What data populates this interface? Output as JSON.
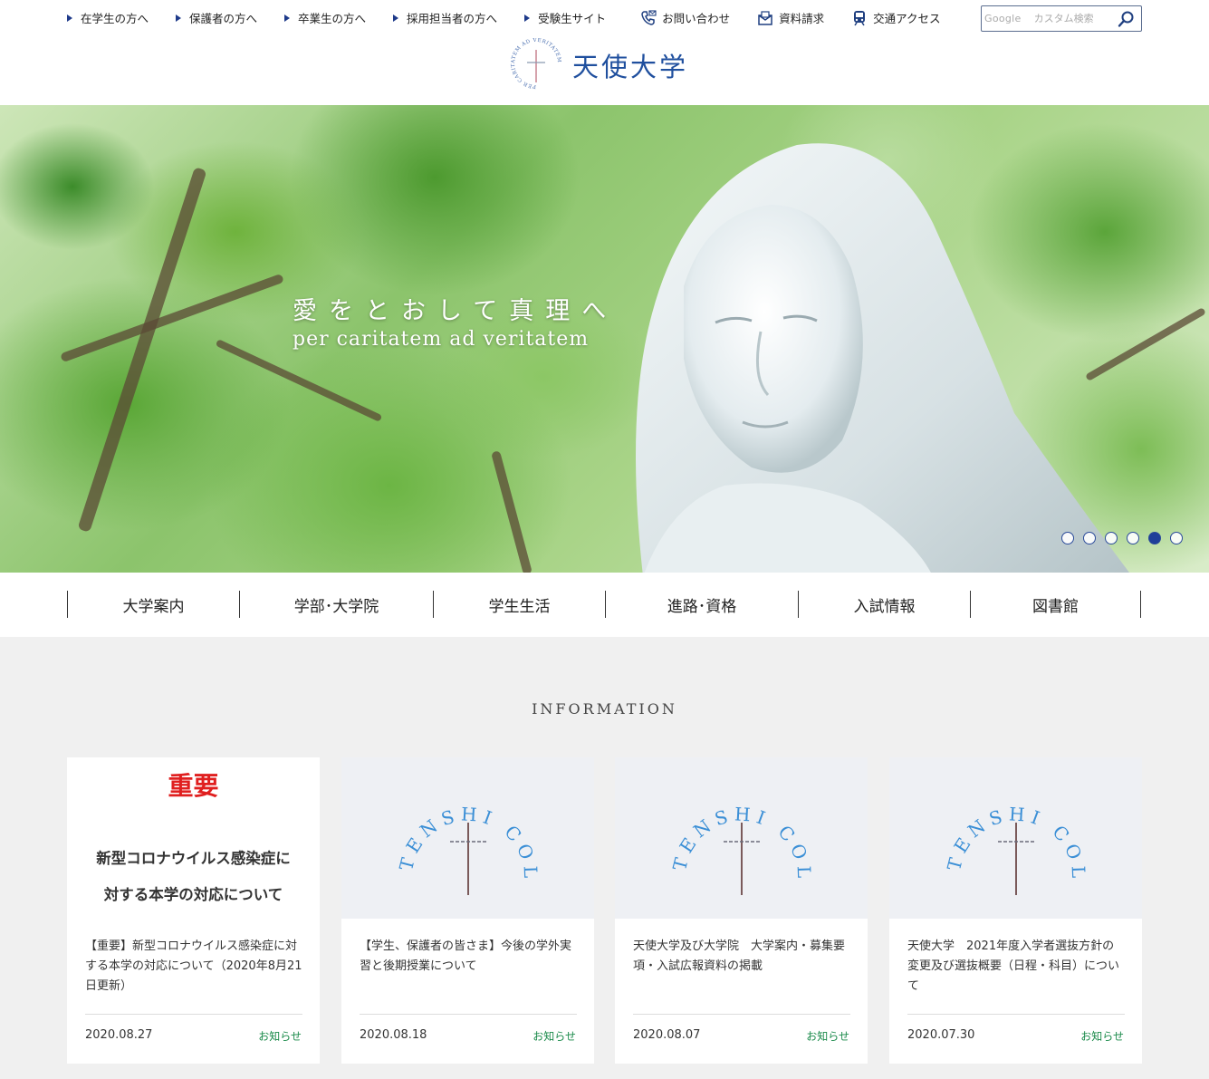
{
  "header": {
    "util_links": [
      {
        "label": "在学生の方へ"
      },
      {
        "label": "保護者の方へ"
      },
      {
        "label": "卒業生の方へ"
      },
      {
        "label": "採用担当者の方へ"
      },
      {
        "label": "受験生サイト"
      }
    ],
    "icon_links": [
      {
        "label": "お問い合わせ",
        "icon": "phone-mail-icon"
      },
      {
        "label": "資料請求",
        "icon": "envelope-icon"
      },
      {
        "label": "交通アクセス",
        "icon": "train-icon"
      }
    ],
    "search": {
      "google_label": "Google",
      "placeholder": "カスタム検索"
    },
    "logo": {
      "name": "天使大学",
      "motto_ring": "PER CARITATEM AD VERITATEM"
    }
  },
  "hero": {
    "tagline_jp": "愛をとおして真理へ",
    "tagline_la": "per caritatem ad veritatem",
    "slides_total": 6,
    "active_slide": 5
  },
  "main_nav": [
    {
      "label": "大学案内"
    },
    {
      "label": "学部･大学院"
    },
    {
      "label": "学生生活"
    },
    {
      "label": "進路･資格"
    },
    {
      "label": "入試情報"
    },
    {
      "label": "図書館"
    }
  ],
  "information": {
    "title": "INFORMATION",
    "cards": [
      {
        "image_type": "important",
        "image_title": "重要",
        "image_sub_1": "新型コロナウイルス感染症に",
        "image_sub_2": "対する本学の対応について",
        "text": "【重要】新型コロナウイルス感染症に対する本学の対応について（2020年8月21日更新）",
        "date": "2020.08.27",
        "tag": "お知らせ"
      },
      {
        "image_type": "college-logo",
        "image_logo_text": "TENSHI COLLEGE",
        "text": "【学生、保護者の皆さま】今後の学外実習と後期授業について",
        "date": "2020.08.18",
        "tag": "お知らせ"
      },
      {
        "image_type": "college-logo",
        "image_logo_text": "TENSHI COLLEGE",
        "text": "天使大学及び大学院　大学案内・募集要項・入試広報資料の掲載",
        "date": "2020.08.07",
        "tag": "お知らせ"
      },
      {
        "image_type": "college-logo",
        "image_logo_text": "TENSHI COLLEGE",
        "text": "天使大学　2021年度入学者選抜方針の変更及び選抜概要（日程・科目）について",
        "date": "2020.07.30",
        "tag": "お知らせ"
      }
    ]
  },
  "colors": {
    "brand_blue": "#1f4f9e",
    "important_red": "#e01f1f",
    "tag_green": "#1a8a4a"
  }
}
